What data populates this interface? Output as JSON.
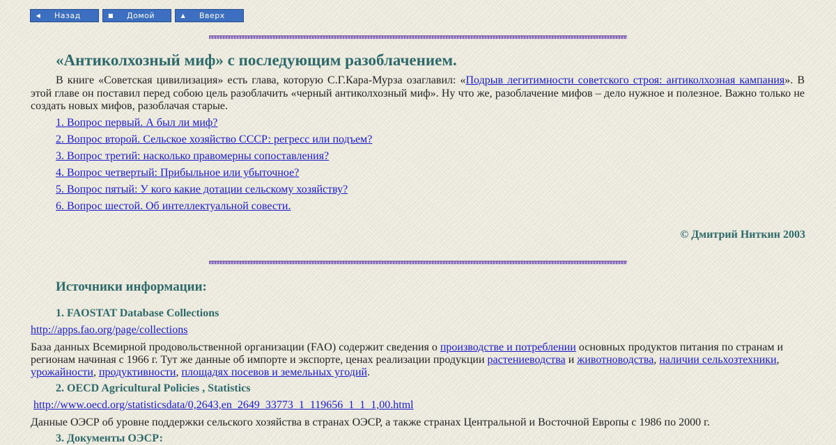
{
  "nav": {
    "back_label": "Назад",
    "home_label": "Домой",
    "up_label": "Вверх",
    "colors": {
      "button_bg": "#3d6fc0",
      "button_text": "#ffffff"
    }
  },
  "article": {
    "title": "«Антиколхозный миф» с последующим разоблачением.",
    "intro_before_link": "В книге «Советская цивилизация» есть глава, которую С.Г.Кара-Мурза озаглавил: «",
    "intro_link": "Подрыв легитимности советского строя: антиколхозная кампания",
    "intro_after_link": "». В этой главе он поставил перед собою цель разоблачить «черный антиколхозный миф». Ну что же, разоблачение мифов – дело нужное и полезное. Важно только не создать новых мифов, разоблачая старые.",
    "toc": [
      "1. Вопрос первый. А был ли миф?",
      "2. Вопрос второй. Сельское хозяйство СССР: регресс или подъем?",
      "3. Вопрос третий: насколько правомерны сопоставления?",
      "4. Вопрос четвертый: Прибыльное или убыточное?",
      "5. Вопрос пятый: У кого какие дотации сельскому хозяйству?",
      "6. Вопрос шестой. Об интеллектуальной совести."
    ],
    "copyright": "© Дмитрий Ниткин 2003"
  },
  "sources": {
    "title": "Источники информации:",
    "items": [
      {
        "heading": "1. FAOSTAT Database Collections",
        "url": "http://apps.fao.org/page/collections",
        "desc_1": "База данных Всемирной продовольственной организации (FAO) содержит сведения о ",
        "link_1": "производстве и потреблении",
        "desc_2": " основных продуктов питания по странам и регионам начиная с 1966 г. Тут же данные об импорте и экспорте, ценах реализации продукции ",
        "link_2": "растениеводства",
        "desc_3": " и ",
        "link_3": "животноводства",
        "desc_4": ", ",
        "link_4": "наличии сельхозтехники",
        "desc_5": ", ",
        "link_5": "урожайности",
        "desc_6": ", ",
        "link_6": "продуктивности",
        "desc_7": ", ",
        "link_7": "площадях посевов и земельных угодий",
        "desc_8": "."
      },
      {
        "heading": "2. OECD Agricultural Policies , Statistics",
        "url": "http://www.oecd.org/statisticsdata/0,2643,en_2649_33773_1_119656_1_1_1,00.html",
        "desc": "Данные ОЭСР об уровне поддержки сельского хозяйства в странах ОЭСР, а также странах Центральной и Восточной Европы с 1986 по 2000 г."
      },
      {
        "heading": "3. Документы ОЭСР:"
      }
    ]
  }
}
